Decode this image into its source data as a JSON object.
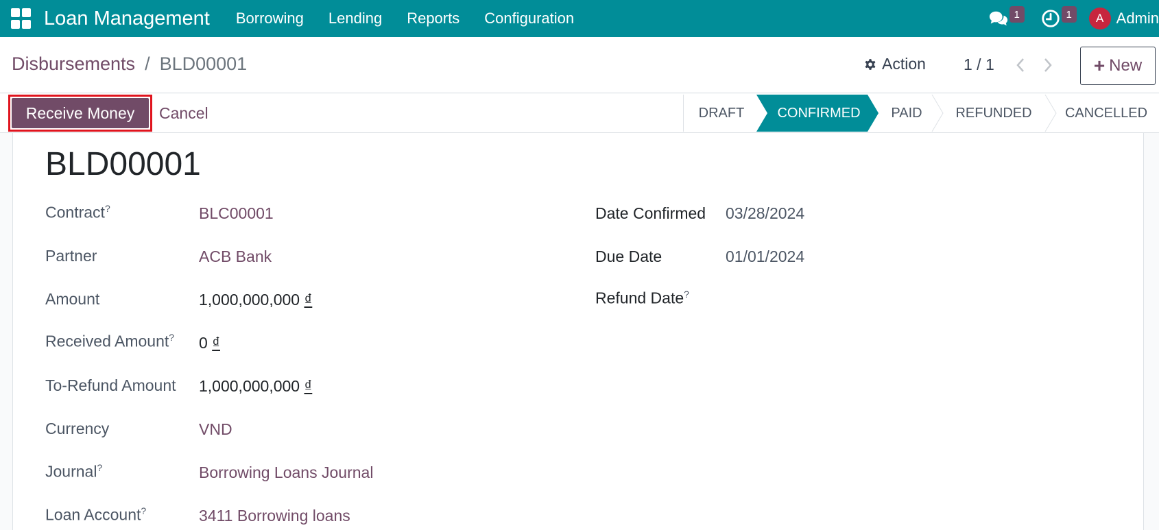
{
  "topbar": {
    "app_title": "Loan Management",
    "nav": [
      "Borrowing",
      "Lending",
      "Reports",
      "Configuration"
    ],
    "messages_count": "1",
    "activities_count": "1",
    "user_initial": "A",
    "user_name": "Admin"
  },
  "control": {
    "breadcrumb_parent": "Disbursements",
    "breadcrumb_separator": "/",
    "breadcrumb_current": "BLD00001",
    "action_label": "Action",
    "pager": "1 / 1",
    "new_label": "New"
  },
  "statusbar": {
    "receive_label": "Receive Money",
    "cancel_label": "Cancel",
    "stages": [
      "DRAFT",
      "CONFIRMED",
      "PAID",
      "REFUNDED",
      "CANCELLED"
    ],
    "active_stage": "CONFIRMED"
  },
  "form": {
    "title": "BLD00001",
    "left": [
      {
        "label": "Contract",
        "help": "?",
        "value": "BLC00001"
      },
      {
        "label": "Partner",
        "help": "",
        "value": "ACB Bank"
      },
      {
        "label": "Amount",
        "help": "",
        "value": "1,000,000,000",
        "currency": "₫"
      },
      {
        "label": "Received Amount",
        "help": "?",
        "value": "0",
        "currency": "₫"
      },
      {
        "label": "To-Refund Amount",
        "help": "",
        "value": "1,000,000,000",
        "currency": "₫"
      },
      {
        "label": "Currency",
        "help": "",
        "value": "VND"
      },
      {
        "label": "Journal",
        "help": "?",
        "value": "Borrowing Loans Journal"
      },
      {
        "label": "Loan Account",
        "help": "?",
        "value": "3411 Borrowing loans"
      }
    ],
    "right": [
      {
        "label": "Date Confirmed",
        "help": "",
        "value": "03/28/2024"
      },
      {
        "label": "Due Date",
        "help": "",
        "value": "01/01/2024"
      },
      {
        "label": "Refund Date",
        "help": "?",
        "value": ""
      }
    ]
  },
  "colors": {
    "navbar": "#018d98",
    "primary": "#714b67",
    "active_stage": "#018d98",
    "highlight": "#e0141e"
  }
}
